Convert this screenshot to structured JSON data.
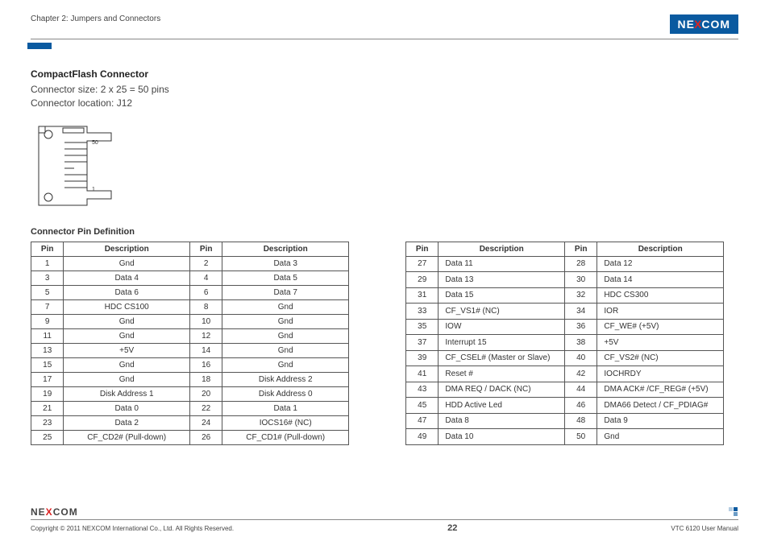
{
  "chapter": "Chapter 2: Jumpers and Connectors",
  "logo": {
    "pre": "NE",
    "x": "X",
    "post": "COM"
  },
  "section_title": "CompactFlash Connector",
  "size_line": "Connector size: 2 x 25 = 50 pins",
  "loc_line": "Connector location: J12",
  "pindef_title": "Connector Pin Definition",
  "headers": {
    "pin": "Pin",
    "desc": "Description"
  },
  "diagram_labels": {
    "top": "50",
    "bot": "1"
  },
  "table_left": [
    {
      "p1": "1",
      "d1": "Gnd",
      "p2": "2",
      "d2": "Data 3"
    },
    {
      "p1": "3",
      "d1": "Data 4",
      "p2": "4",
      "d2": "Data 5"
    },
    {
      "p1": "5",
      "d1": "Data 6",
      "p2": "6",
      "d2": "Data 7"
    },
    {
      "p1": "7",
      "d1": "HDC CS100",
      "p2": "8",
      "d2": "Gnd"
    },
    {
      "p1": "9",
      "d1": "Gnd",
      "p2": "10",
      "d2": "Gnd"
    },
    {
      "p1": "11",
      "d1": "Gnd",
      "p2": "12",
      "d2": "Gnd"
    },
    {
      "p1": "13",
      "d1": "+5V",
      "p2": "14",
      "d2": "Gnd"
    },
    {
      "p1": "15",
      "d1": "Gnd",
      "p2": "16",
      "d2": "Gnd"
    },
    {
      "p1": "17",
      "d1": "Gnd",
      "p2": "18",
      "d2": "Disk Address 2"
    },
    {
      "p1": "19",
      "d1": "Disk Address 1",
      "p2": "20",
      "d2": "Disk Address 0"
    },
    {
      "p1": "21",
      "d1": "Data 0",
      "p2": "22",
      "d2": "Data 1"
    },
    {
      "p1": "23",
      "d1": "Data 2",
      "p2": "24",
      "d2": "IOCS16# (NC)"
    },
    {
      "p1": "25",
      "d1": "CF_CD2# (Pull-down)",
      "p2": "26",
      "d2": "CF_CD1# (Pull-down)"
    }
  ],
  "table_right": [
    {
      "p1": "27",
      "d1": "Data 11",
      "p2": "28",
      "d2": "Data 12"
    },
    {
      "p1": "29",
      "d1": "Data 13",
      "p2": "30",
      "d2": "Data 14"
    },
    {
      "p1": "31",
      "d1": "Data 15",
      "p2": "32",
      "d2": "HDC CS300"
    },
    {
      "p1": "33",
      "d1": "CF_VS1# (NC)",
      "p2": "34",
      "d2": "IOR"
    },
    {
      "p1": "35",
      "d1": "IOW",
      "p2": "36",
      "d2": "CF_WE# (+5V)"
    },
    {
      "p1": "37",
      "d1": "Interrupt 15",
      "p2": "38",
      "d2": "+5V"
    },
    {
      "p1": "39",
      "d1": "CF_CSEL# (Master or Slave)",
      "p2": "40",
      "d2": "CF_VS2# (NC)"
    },
    {
      "p1": "41",
      "d1": "Reset #",
      "p2": "42",
      "d2": "IOCHRDY"
    },
    {
      "p1": "43",
      "d1": "DMA REQ / DACK (NC)",
      "p2": "44",
      "d2": "DMA ACK# /CF_REG# (+5V)"
    },
    {
      "p1": "45",
      "d1": "HDD Active Led",
      "p2": "46",
      "d2": "DMA66 Detect / CF_PDIAG#"
    },
    {
      "p1": "47",
      "d1": "Data 8",
      "p2": "48",
      "d2": "Data 9"
    },
    {
      "p1": "49",
      "d1": "Data 10",
      "p2": "50",
      "d2": "Gnd"
    }
  ],
  "footer": {
    "copyright": "Copyright © 2011 NEXCOM International Co., Ltd. All Rights Reserved.",
    "page": "22",
    "doc": "VTC 6120 User Manual"
  }
}
